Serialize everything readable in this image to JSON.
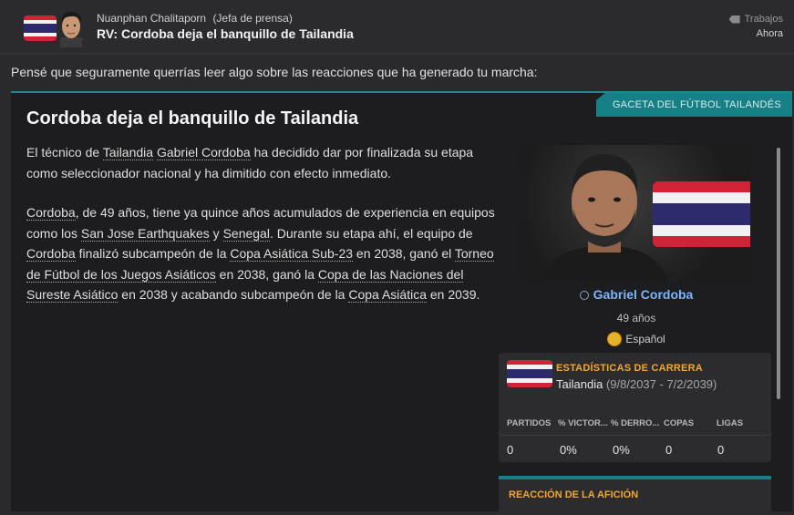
{
  "message": {
    "sender_name": "Nuanphan Chalitaporn",
    "sender_role": "(Jefa de prensa)",
    "subject": "RV: Cordoba deja el banquillo de Tailandia",
    "tag": "Trabajos",
    "date": "Ahora",
    "intro": "Pensé que seguramente querrías leer algo sobre las reacciones que ha generado tu marcha:"
  },
  "article": {
    "source": "GACETA DEL FÚTBOL TAILANDÉS",
    "headline": "Cordoba deja el banquillo de Tailandia",
    "p1": {
      "a": "El técnico de ",
      "l1": "Tailandia",
      "b": " ",
      "l2": "Gabriel Cordoba",
      "c": " ha decidido dar por finalizada su etapa como seleccionador nacional y ha dimitido con efecto inmediato."
    },
    "p2": {
      "l1": "Cordoba",
      "a": ", de 49 años, tiene ya quince años acumulados de experiencia en equipos como los ",
      "l2": "San Jose Earthquakes",
      "b": " y ",
      "l3": "Senegal",
      "c": ". Durante su etapa ahí, el equipo de ",
      "l4": "Cordoba",
      "d": " finalizó subcampeón de la ",
      "l5": "Copa Asiática Sub-23",
      "e": " en 2038, ganó el ",
      "l6": "Torneo de Fútbol de los Juegos Asiáticos",
      "f": " en 2038, ganó la ",
      "l7": "Copa de las Naciones del Sureste Asiático",
      "g": " en 2038 y acabando subcampeón de la ",
      "l8": "Copa Asiática",
      "h": " en 2039."
    }
  },
  "player": {
    "name": "Gabriel Cordoba",
    "age": "49 años",
    "language": "Español"
  },
  "career_stats": {
    "title": "ESTADÍSTICAS DE CARRERA",
    "team": "Tailandia",
    "period": "(9/8/2037 - 7/2/2039)",
    "headers": [
      "PARTIDOS",
      "% VICTOR...",
      "% DERRO...",
      "COPAS",
      "LIGAS"
    ],
    "values": [
      "0",
      "0%",
      "0%",
      "0",
      "0"
    ]
  },
  "reaction": {
    "title": "REACCIÓN DE LA AFICIÓN"
  },
  "colors": {
    "accent_teal": "#177f86",
    "link_blue": "#79b5ff",
    "orange_title": "#f0a830",
    "thai_red": "#d12337",
    "thai_white": "#f1f1f1",
    "thai_blue": "#2d2a6e"
  }
}
